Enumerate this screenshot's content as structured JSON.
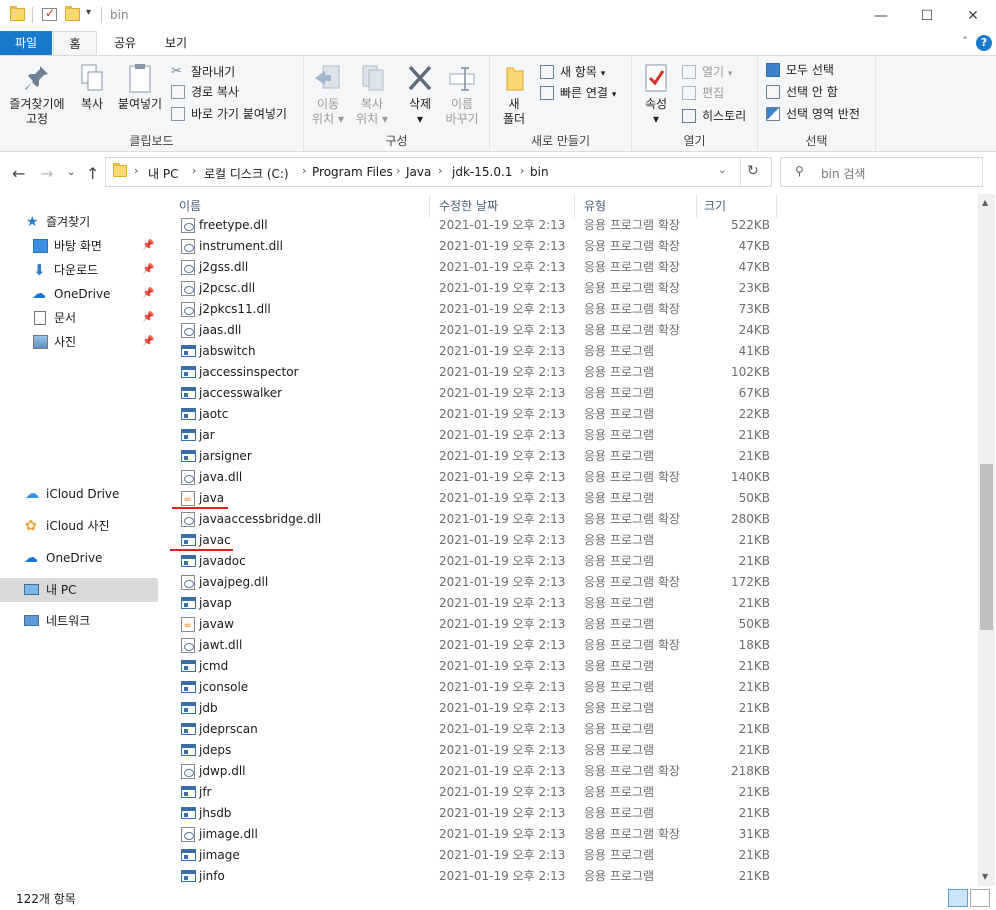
{
  "window": {
    "title": "bin"
  },
  "window_controls": {
    "minimize": "—",
    "maximize": "☐",
    "close": "✕"
  },
  "ribbon_tabs": [
    {
      "label": "파일"
    },
    {
      "label": "홈"
    },
    {
      "label": "공유"
    },
    {
      "label": "보기"
    }
  ],
  "help": {
    "label": "?"
  },
  "ribbon": {
    "clipboard": {
      "pin_label_1": "즐겨찾기에",
      "pin_label_2": "고정",
      "copy": "복사",
      "paste": "붙여넣기",
      "cut": "잘라내기",
      "copy_path": "경로 복사",
      "paste_shortcut": "바로 가기 붙여넣기",
      "group": "클립보드"
    },
    "organize": {
      "move_to_1": "이동",
      "move_to_2": "위치",
      "copy_to_1": "복사",
      "copy_to_2": "위치",
      "delete": "삭제",
      "rename_1": "이름",
      "rename_2": "바꾸기",
      "group": "구성"
    },
    "new": {
      "new_folder_1": "새",
      "new_folder_2": "폴더",
      "new_item": "새 항목",
      "easy_access": "빠른 연결",
      "group": "새로 만들기"
    },
    "open": {
      "properties": "속성",
      "open": "열기",
      "edit": "편집",
      "history": "히스토리",
      "group": "열기"
    },
    "select": {
      "select_all": "모두 선택",
      "select_none": "선택 안 함",
      "invert": "선택 영역 반전",
      "group": "선택"
    }
  },
  "address": {
    "crumbs": [
      "내 PC",
      "로컬 디스크 (C:)",
      "Program Files",
      "Java",
      "jdk-15.0.1",
      "bin"
    ],
    "search_placeholder": "bin 검색"
  },
  "nav": {
    "quick_access": "즐겨찾기",
    "desktop": "바탕 화면",
    "downloads": "다운로드",
    "onedrive_pinned": "OneDrive",
    "documents": "문서",
    "pictures": "사진",
    "icloud_drive": "iCloud Drive",
    "icloud_photos": "iCloud 사진",
    "onedrive": "OneDrive",
    "this_pc": "내 PC",
    "network": "네트워크"
  },
  "columns": {
    "name": "이름",
    "date": "수정한 날짜",
    "type": "유형",
    "size": "크기"
  },
  "files": [
    {
      "name": "freetype.dll",
      "date": "2021-01-19 오후 2:13",
      "type": "응용 프로그램 확장",
      "size": "522KB",
      "icon": "dll"
    },
    {
      "name": "instrument.dll",
      "date": "2021-01-19 오후 2:13",
      "type": "응용 프로그램 확장",
      "size": "47KB",
      "icon": "dll"
    },
    {
      "name": "j2gss.dll",
      "date": "2021-01-19 오후 2:13",
      "type": "응용 프로그램 확장",
      "size": "47KB",
      "icon": "dll"
    },
    {
      "name": "j2pcsc.dll",
      "date": "2021-01-19 오후 2:13",
      "type": "응용 프로그램 확장",
      "size": "23KB",
      "icon": "dll"
    },
    {
      "name": "j2pkcs11.dll",
      "date": "2021-01-19 오후 2:13",
      "type": "응용 프로그램 확장",
      "size": "73KB",
      "icon": "dll"
    },
    {
      "name": "jaas.dll",
      "date": "2021-01-19 오후 2:13",
      "type": "응용 프로그램 확장",
      "size": "24KB",
      "icon": "dll"
    },
    {
      "name": "jabswitch",
      "date": "2021-01-19 오후 2:13",
      "type": "응용 프로그램",
      "size": "41KB",
      "icon": "exe"
    },
    {
      "name": "jaccessinspector",
      "date": "2021-01-19 오후 2:13",
      "type": "응용 프로그램",
      "size": "102KB",
      "icon": "exe"
    },
    {
      "name": "jaccesswalker",
      "date": "2021-01-19 오후 2:13",
      "type": "응용 프로그램",
      "size": "67KB",
      "icon": "exe"
    },
    {
      "name": "jaotc",
      "date": "2021-01-19 오후 2:13",
      "type": "응용 프로그램",
      "size": "22KB",
      "icon": "exe"
    },
    {
      "name": "jar",
      "date": "2021-01-19 오후 2:13",
      "type": "응용 프로그램",
      "size": "21KB",
      "icon": "exe"
    },
    {
      "name": "jarsigner",
      "date": "2021-01-19 오후 2:13",
      "type": "응용 프로그램",
      "size": "21KB",
      "icon": "exe"
    },
    {
      "name": "java.dll",
      "date": "2021-01-19 오후 2:13",
      "type": "응용 프로그램 확장",
      "size": "140KB",
      "icon": "dll"
    },
    {
      "name": "java",
      "date": "2021-01-19 오후 2:13",
      "type": "응용 프로그램",
      "size": "50KB",
      "icon": "java"
    },
    {
      "name": "javaaccessbridge.dll",
      "date": "2021-01-19 오후 2:13",
      "type": "응용 프로그램 확장",
      "size": "280KB",
      "icon": "dll"
    },
    {
      "name": "javac",
      "date": "2021-01-19 오후 2:13",
      "type": "응용 프로그램",
      "size": "21KB",
      "icon": "exe"
    },
    {
      "name": "javadoc",
      "date": "2021-01-19 오후 2:13",
      "type": "응용 프로그램",
      "size": "21KB",
      "icon": "exe"
    },
    {
      "name": "javajpeg.dll",
      "date": "2021-01-19 오후 2:13",
      "type": "응용 프로그램 확장",
      "size": "172KB",
      "icon": "dll"
    },
    {
      "name": "javap",
      "date": "2021-01-19 오후 2:13",
      "type": "응용 프로그램",
      "size": "21KB",
      "icon": "exe"
    },
    {
      "name": "javaw",
      "date": "2021-01-19 오후 2:13",
      "type": "응용 프로그램",
      "size": "50KB",
      "icon": "java"
    },
    {
      "name": "jawt.dll",
      "date": "2021-01-19 오후 2:13",
      "type": "응용 프로그램 확장",
      "size": "18KB",
      "icon": "dll"
    },
    {
      "name": "jcmd",
      "date": "2021-01-19 오후 2:13",
      "type": "응용 프로그램",
      "size": "21KB",
      "icon": "exe"
    },
    {
      "name": "jconsole",
      "date": "2021-01-19 오후 2:13",
      "type": "응용 프로그램",
      "size": "21KB",
      "icon": "exe"
    },
    {
      "name": "jdb",
      "date": "2021-01-19 오후 2:13",
      "type": "응용 프로그램",
      "size": "21KB",
      "icon": "exe"
    },
    {
      "name": "jdeprscan",
      "date": "2021-01-19 오후 2:13",
      "type": "응용 프로그램",
      "size": "21KB",
      "icon": "exe"
    },
    {
      "name": "jdeps",
      "date": "2021-01-19 오후 2:13",
      "type": "응용 프로그램",
      "size": "21KB",
      "icon": "exe"
    },
    {
      "name": "jdwp.dll",
      "date": "2021-01-19 오후 2:13",
      "type": "응용 프로그램 확장",
      "size": "218KB",
      "icon": "dll"
    },
    {
      "name": "jfr",
      "date": "2021-01-19 오후 2:13",
      "type": "응용 프로그램",
      "size": "21KB",
      "icon": "exe"
    },
    {
      "name": "jhsdb",
      "date": "2021-01-19 오후 2:13",
      "type": "응용 프로그램",
      "size": "21KB",
      "icon": "exe"
    },
    {
      "name": "jimage.dll",
      "date": "2021-01-19 오후 2:13",
      "type": "응용 프로그램 확장",
      "size": "31KB",
      "icon": "dll"
    },
    {
      "name": "jimage",
      "date": "2021-01-19 오후 2:13",
      "type": "응용 프로그램",
      "size": "21KB",
      "icon": "exe"
    },
    {
      "name": "jinfo",
      "date": "2021-01-19 오후 2:13",
      "type": "응용 프로그램",
      "size": "21KB",
      "icon": "exe"
    }
  ],
  "annotations": {
    "underlined_files": [
      "java",
      "javac"
    ],
    "underline_color": "#e0201f"
  },
  "status": {
    "item_count": "122개 항목"
  },
  "colors": {
    "accent": "#1979ca",
    "ribbon_bg": "#f5f6f7",
    "selected_nav": "#d9d9d9",
    "header_text": "#4c607a"
  }
}
